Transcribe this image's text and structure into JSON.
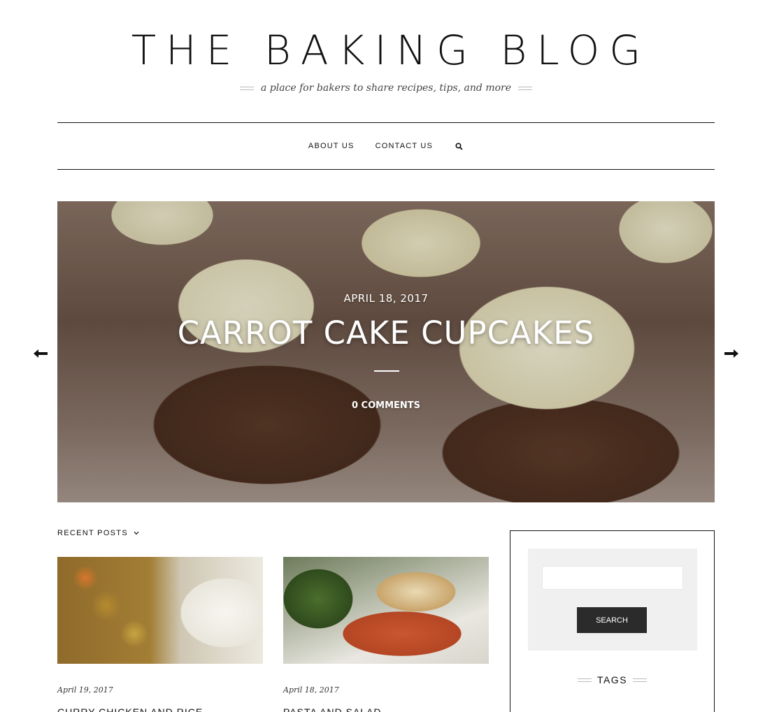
{
  "header": {
    "site_title": "THE BAKING BLOG",
    "tagline": "a place for bakers to share recipes, tips, and more"
  },
  "nav": {
    "items": [
      "ABOUT US",
      "CONTACT US"
    ],
    "search_icon": "search-icon"
  },
  "hero": {
    "date": "APRIL 18, 2017",
    "title": "CARROT CAKE CUPCAKES",
    "comments": "0 COMMENTS",
    "prev_icon": "arrow-left-icon",
    "next_icon": "arrow-right-icon"
  },
  "recent_posts": {
    "heading": "RECENT POSTS",
    "icon": "chevron-down-icon",
    "posts": [
      {
        "date": "April 19, 2017",
        "title": "CURRY CHICKEN AND RICE"
      },
      {
        "date": "April 18, 2017",
        "title": "PASTA AND SALAD"
      }
    ]
  },
  "sidebar": {
    "search": {
      "value": "",
      "placeholder": "",
      "button_label": "SEARCH"
    },
    "tags_heading": "TAGS"
  }
}
